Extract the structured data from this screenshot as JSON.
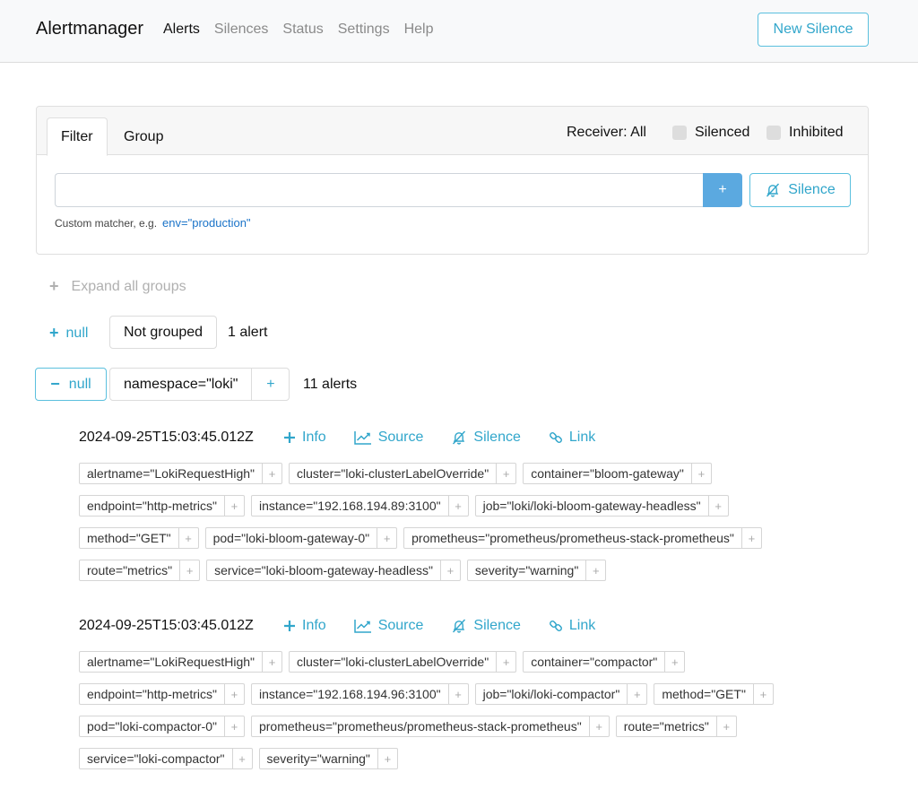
{
  "navbar": {
    "brand": "Alertmanager",
    "links": [
      "Alerts",
      "Silences",
      "Status",
      "Settings",
      "Help"
    ],
    "new_silence": "New Silence"
  },
  "filter": {
    "tab_filter": "Filter",
    "tab_group": "Group",
    "receiver": "Receiver: All",
    "silenced": "Silenced",
    "inhibited": "Inhibited",
    "input_value": "",
    "plus": "+",
    "silence_button": "Silence",
    "hint": "Custom matcher, e.g.",
    "hint_example": "env=\"production\""
  },
  "expand_all": "Expand all groups",
  "group1": {
    "toggle": "null",
    "label": "Not grouped",
    "count": "1 alert"
  },
  "group2": {
    "toggle": "null",
    "label": "namespace=\"loki\"",
    "add": "+",
    "count": "11 alerts"
  },
  "actions": {
    "info": "Info",
    "source": "Source",
    "silence": "Silence",
    "link": "Link"
  },
  "alerts": [
    {
      "timestamp": "2024-09-25T15:03:45.012Z",
      "labels": [
        "alertname=\"LokiRequestHigh\"",
        "cluster=\"loki-clusterLabelOverride\"",
        "container=\"bloom-gateway\"",
        "endpoint=\"http-metrics\"",
        "instance=\"192.168.194.89:3100\"",
        "job=\"loki/loki-bloom-gateway-headless\"",
        "method=\"GET\"",
        "pod=\"loki-bloom-gateway-0\"",
        "prometheus=\"prometheus/prometheus-stack-prometheus\"",
        "route=\"metrics\"",
        "service=\"loki-bloom-gateway-headless\"",
        "severity=\"warning\""
      ]
    },
    {
      "timestamp": "2024-09-25T15:03:45.012Z",
      "labels": [
        "alertname=\"LokiRequestHigh\"",
        "cluster=\"loki-clusterLabelOverride\"",
        "container=\"compactor\"",
        "endpoint=\"http-metrics\"",
        "instance=\"192.168.194.96:3100\"",
        "job=\"loki/loki-compactor\"",
        "method=\"GET\"",
        "pod=\"loki-compactor-0\"",
        "prometheus=\"prometheus/prometheus-stack-prometheus\"",
        "route=\"metrics\"",
        "service=\"loki-compactor\"",
        "severity=\"warning\""
      ]
    }
  ],
  "colors": {
    "accent": "#31a6cb",
    "primary": "#5ba9e0"
  }
}
